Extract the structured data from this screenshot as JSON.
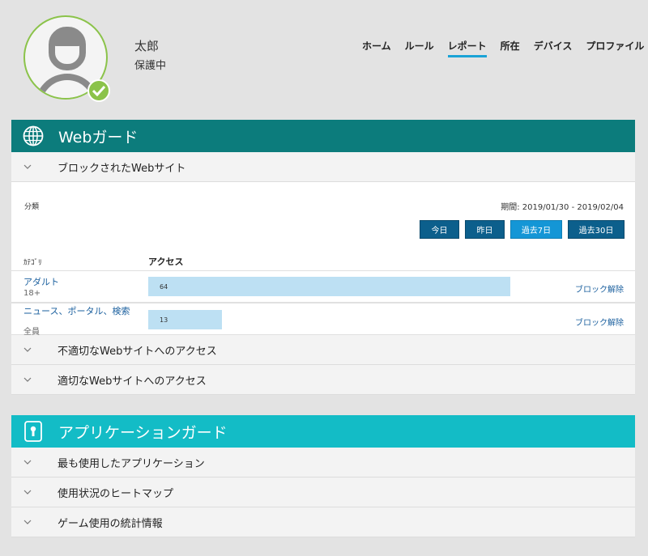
{
  "user": {
    "name": "太郎",
    "status": "保護中"
  },
  "nav": {
    "items": [
      {
        "label": "ホーム",
        "active": false
      },
      {
        "label": "ルール",
        "active": false
      },
      {
        "label": "レポート",
        "active": true
      },
      {
        "label": "所在",
        "active": false
      },
      {
        "label": "デバイス",
        "active": false
      },
      {
        "label": "プロファイル",
        "active": false
      }
    ]
  },
  "web_guard": {
    "title": "Webガード",
    "icon": "globe-icon",
    "color": "#0c7c7c",
    "blocked": {
      "label": "ブロックされたWebサイト",
      "category_label": "分類",
      "period": "期間: 2019/01/30 - 2019/02/04",
      "buttons": [
        {
          "label": "今日",
          "active": false
        },
        {
          "label": "昨日",
          "active": false
        },
        {
          "label": "過去7日",
          "active": true
        },
        {
          "label": "過去30日",
          "active": false
        }
      ],
      "col_category": "ｶﾃｺﾞﾘ",
      "col_access": "アクセス",
      "rows": [
        {
          "name": "アダルト",
          "sub": "18+",
          "count": "64",
          "action": "ブロック解除",
          "fraction": 1.0
        },
        {
          "name": "ニュース、ポータル、検索",
          "sub": "全員",
          "count": "13",
          "action": "ブロック解除",
          "fraction": 0.203
        }
      ]
    },
    "sections": [
      "不適切なWebサイトへのアクセス",
      "適切なWebサイトへのアクセス"
    ]
  },
  "app_guard": {
    "title": "アプリケーションガード",
    "icon": "lock-icon",
    "color": "#13bcc6",
    "sections": [
      "最も使用したアプリケーション",
      "使用状況のヒートマップ",
      "ゲーム使用の統計情報"
    ]
  }
}
